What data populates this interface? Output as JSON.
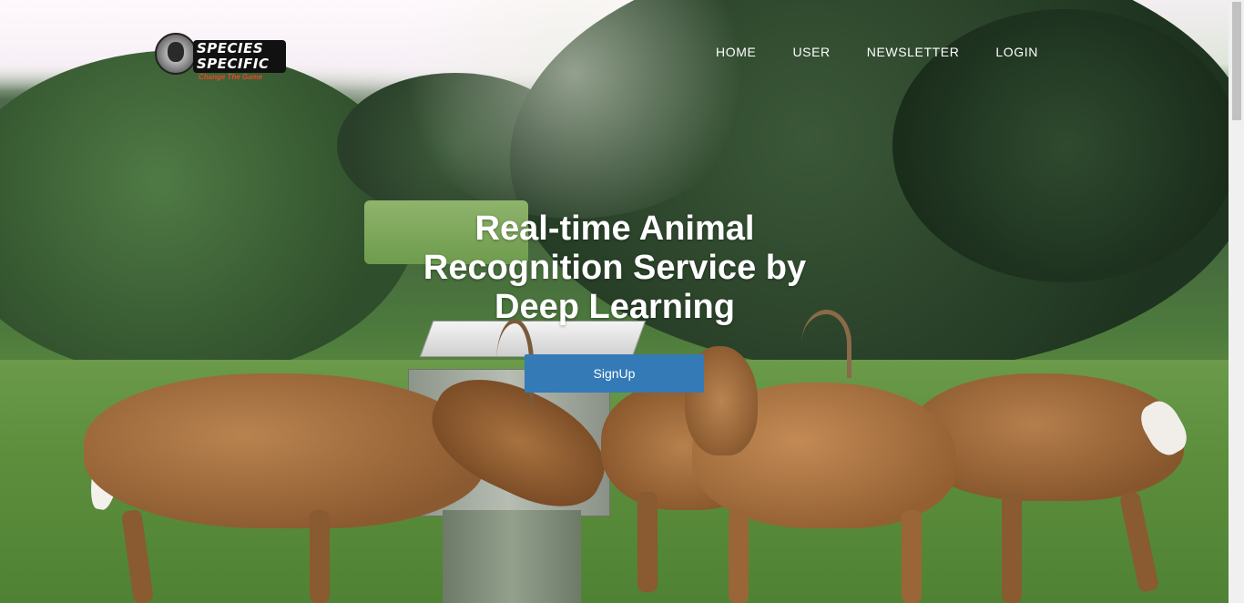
{
  "brand": {
    "line1": "SPECIES",
    "line2": "SPECIFIC",
    "tagline": "Change The Game"
  },
  "nav": {
    "items": [
      {
        "label": "HOME"
      },
      {
        "label": "USER"
      },
      {
        "label": "NEWSLETTER"
      },
      {
        "label": "LOGIN"
      }
    ]
  },
  "hero": {
    "headline": "Real-time Animal Recognition Service by Deep Learning",
    "cta_label": "SignUp",
    "cta_color": "#337ab7"
  }
}
